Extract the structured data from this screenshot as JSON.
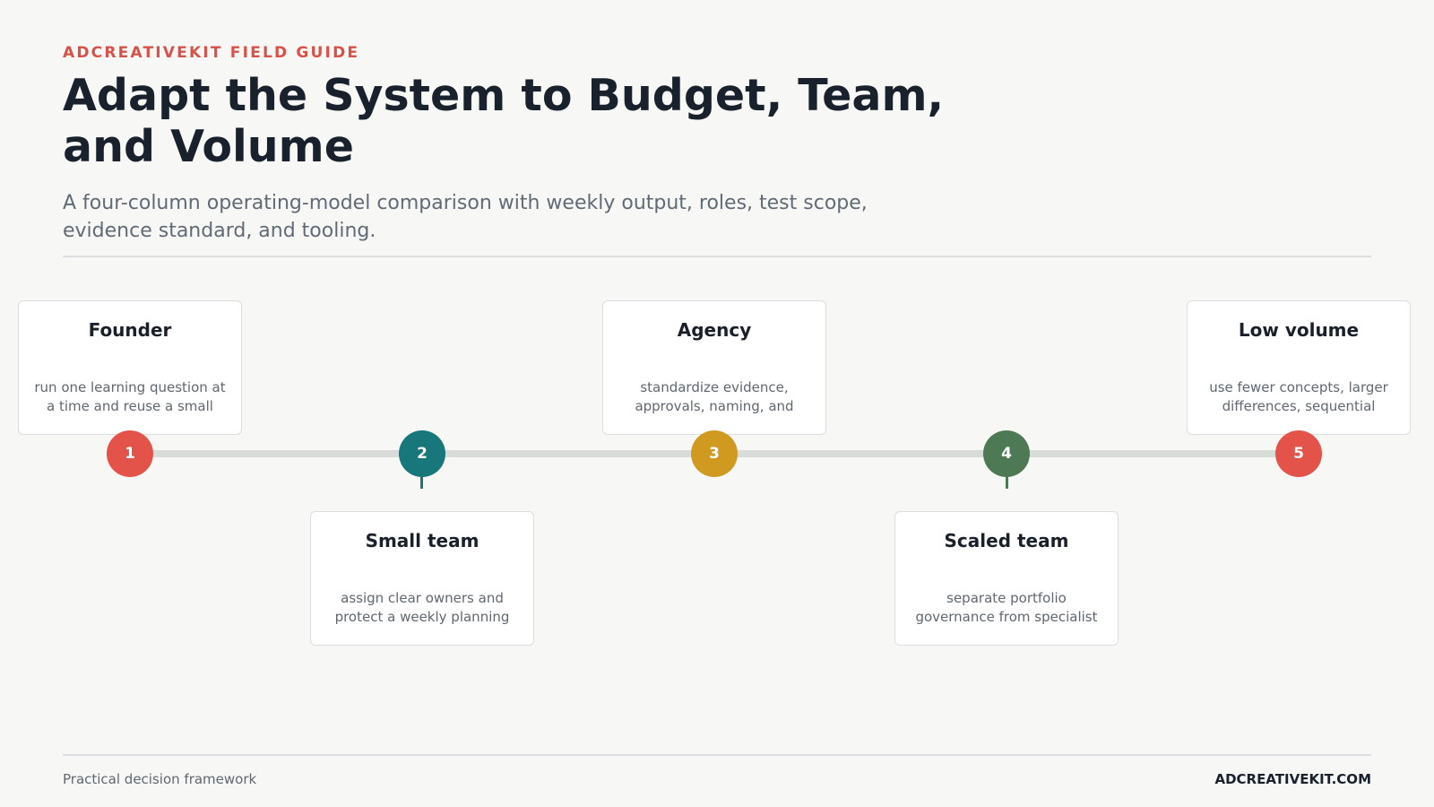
{
  "header": {
    "eyebrow": "ADCREATIVEKIT FIELD GUIDE",
    "title": "Adapt the System to Budget, Team, and Volume",
    "subtitle": "A four-column operating-model comparison with weekly output, roles, test scope, evidence standard, and tooling."
  },
  "timeline": {
    "steps": [
      {
        "number": "1",
        "title": "Founder",
        "body": "run one learning question at a time and reuse a small",
        "color": "#e4534a",
        "position": "above"
      },
      {
        "number": "2",
        "title": "Small team",
        "body": "assign clear owners and protect a weekly planning",
        "color": "#17777a",
        "position": "below"
      },
      {
        "number": "3",
        "title": "Agency",
        "body": "standardize evidence, approvals, naming, and",
        "color": "#cf9a1f",
        "position": "above"
      },
      {
        "number": "4",
        "title": "Scaled team",
        "body": "separate portfolio governance from specialist",
        "color": "#4d7a55",
        "position": "below"
      },
      {
        "number": "5",
        "title": "Low volume",
        "body": "use fewer concepts, larger differences, sequential",
        "color": "#e4534a",
        "position": "above"
      }
    ]
  },
  "footer": {
    "left": "Practical decision framework",
    "right": "ADCREATIVEKIT.COM"
  }
}
